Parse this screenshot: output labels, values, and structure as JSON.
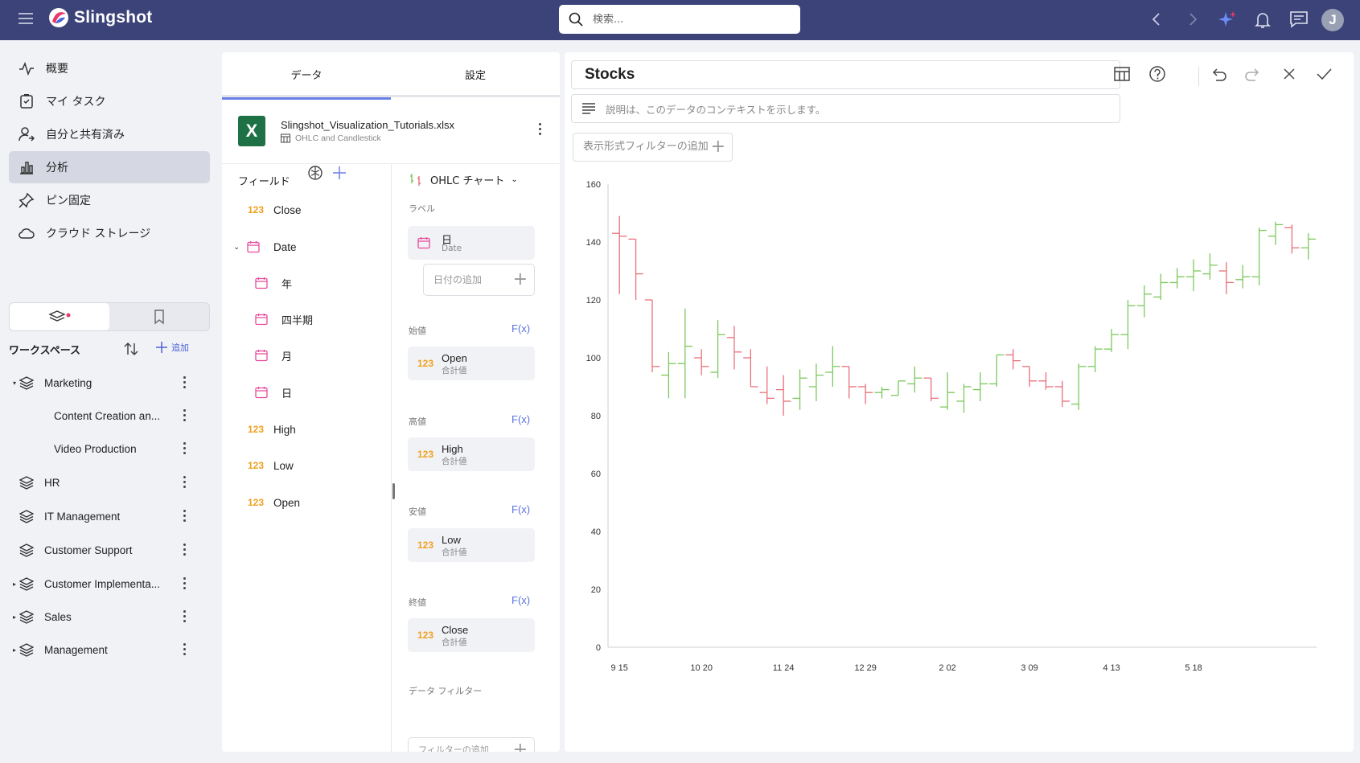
{
  "app": {
    "name": "Slingshot",
    "search_placeholder": "検索...",
    "avatar_initial": "J",
    "colors": {
      "topbar": "#3b4379",
      "accent": "#6b7fe6",
      "up": "#7cc85c",
      "down": "#e8707a",
      "number_badge": "#f0a020"
    }
  },
  "nav": {
    "items": [
      {
        "label": "概要",
        "icon": "activity-icon"
      },
      {
        "label": "マイ タスク",
        "icon": "clipboard-check-icon"
      },
      {
        "label": "自分と共有済み",
        "icon": "user-share-icon"
      },
      {
        "label": "分析",
        "icon": "bar-chart-icon",
        "active": true
      },
      {
        "label": "ピン固定",
        "icon": "pin-icon"
      },
      {
        "label": "クラウド ストレージ",
        "icon": "cloud-icon"
      }
    ]
  },
  "workspaces": {
    "title": "ワークスペース",
    "add_label": "追加",
    "items": [
      {
        "label": "Marketing",
        "expanded": true
      },
      {
        "label": "Content Creation an...",
        "child": true
      },
      {
        "label": "Video Production",
        "child": true
      },
      {
        "label": "HR"
      },
      {
        "label": "IT Management"
      },
      {
        "label": "Customer Support"
      },
      {
        "label": "Customer Implementa..."
      },
      {
        "label": "Sales"
      },
      {
        "label": "Management"
      }
    ]
  },
  "data_panel": {
    "tabs": [
      "データ",
      "設定"
    ],
    "file": {
      "name": "Slingshot_Visualization_Tutorials.xlsx",
      "sheet": "OHLC and Candlestick",
      "icon_letter": "X"
    },
    "fields_title": "フィールド",
    "fields": [
      {
        "type": "123",
        "label": "Close"
      },
      {
        "type": "date",
        "label": "Date"
      },
      {
        "type": "date-sub",
        "label": "年"
      },
      {
        "type": "date-sub",
        "label": "四半期"
      },
      {
        "type": "date-sub",
        "label": "月"
      },
      {
        "type": "date-sub",
        "label": "日"
      },
      {
        "type": "123",
        "label": "High"
      },
      {
        "type": "123",
        "label": "Low"
      },
      {
        "type": "123",
        "label": "Open"
      }
    ],
    "chart_type": "OHLC チャート",
    "label_section": "ラベル",
    "label_pill": {
      "title": "日",
      "sub": "Date"
    },
    "add_date": "日付の追加",
    "fx": "F(x)",
    "sections": [
      {
        "label": "始値",
        "value": "Open",
        "agg": "合計値"
      },
      {
        "label": "高値",
        "value": "High",
        "agg": "合計値"
      },
      {
        "label": "安値",
        "value": "Low",
        "agg": "合計値"
      },
      {
        "label": "終値",
        "value": "Close",
        "agg": "合計値"
      }
    ],
    "data_filter": "データ フィルター",
    "add_filter": "フィルターの追加"
  },
  "chart_panel": {
    "title": "Stocks",
    "description_placeholder": "説明は、このデータのコンテキストを示します。",
    "add_filter": "表示形式フィルターの追加"
  },
  "chart_data": {
    "type": "ohlc",
    "title": "",
    "xlabel": "",
    "ylabel": "",
    "ylim": [
      0,
      160
    ],
    "y_ticks": [
      0,
      20,
      40,
      60,
      80,
      100,
      120,
      140,
      160
    ],
    "x_tick_labels": [
      "9 15",
      "10 20",
      "11 24",
      "12 29",
      "2 02",
      "3 09",
      "4 13",
      "5 18"
    ],
    "x_tick_index": [
      0,
      5,
      10,
      15,
      20,
      25,
      30,
      35
    ],
    "ohlc": [
      [
        143,
        149,
        122,
        142
      ],
      [
        141,
        141,
        120,
        129
      ],
      [
        120,
        120,
        95,
        97
      ],
      [
        94,
        102,
        86,
        98
      ],
      [
        98,
        117,
        86,
        104
      ],
      [
        100,
        103,
        94,
        97
      ],
      [
        95,
        113,
        93,
        108
      ],
      [
        107,
        111,
        96,
        102
      ],
      [
        100,
        103,
        90,
        90
      ],
      [
        88,
        97,
        84,
        86
      ],
      [
        89,
        94,
        80,
        85
      ],
      [
        86,
        96,
        82,
        93
      ],
      [
        90,
        98,
        85,
        94
      ],
      [
        95,
        104,
        90,
        97
      ],
      [
        97,
        97,
        86,
        90
      ],
      [
        90,
        91,
        84,
        88
      ],
      [
        88,
        90,
        86,
        89
      ],
      [
        87,
        92,
        87,
        92
      ],
      [
        91,
        97,
        88,
        93
      ],
      [
        93,
        93,
        85,
        86
      ],
      [
        83,
        95,
        82,
        88
      ],
      [
        85,
        91,
        81,
        90
      ],
      [
        89,
        95,
        85,
        91
      ],
      [
        91,
        101,
        90,
        101
      ],
      [
        101,
        103,
        96,
        99
      ],
      [
        97,
        97,
        90,
        92
      ],
      [
        92,
        95,
        89,
        90
      ],
      [
        90,
        92,
        83,
        85
      ],
      [
        84,
        98,
        82,
        97
      ],
      [
        97,
        104,
        95,
        103
      ],
      [
        103,
        110,
        102,
        108
      ],
      [
        108,
        120,
        103,
        118
      ],
      [
        118,
        125,
        114,
        122
      ],
      [
        121,
        129,
        120,
        126
      ],
      [
        126,
        131,
        124,
        128
      ],
      [
        128,
        134,
        123,
        130
      ],
      [
        129,
        136,
        127,
        132
      ],
      [
        130,
        133,
        122,
        126
      ],
      [
        127,
        132,
        124,
        128
      ],
      [
        128,
        145,
        125,
        144
      ],
      [
        142,
        147,
        139,
        146
      ],
      [
        145,
        146,
        136,
        138
      ],
      [
        138,
        143,
        134,
        141
      ]
    ],
    "colors": {
      "up": "#7cc85c",
      "down": "#e8707a"
    },
    "grid": false
  }
}
